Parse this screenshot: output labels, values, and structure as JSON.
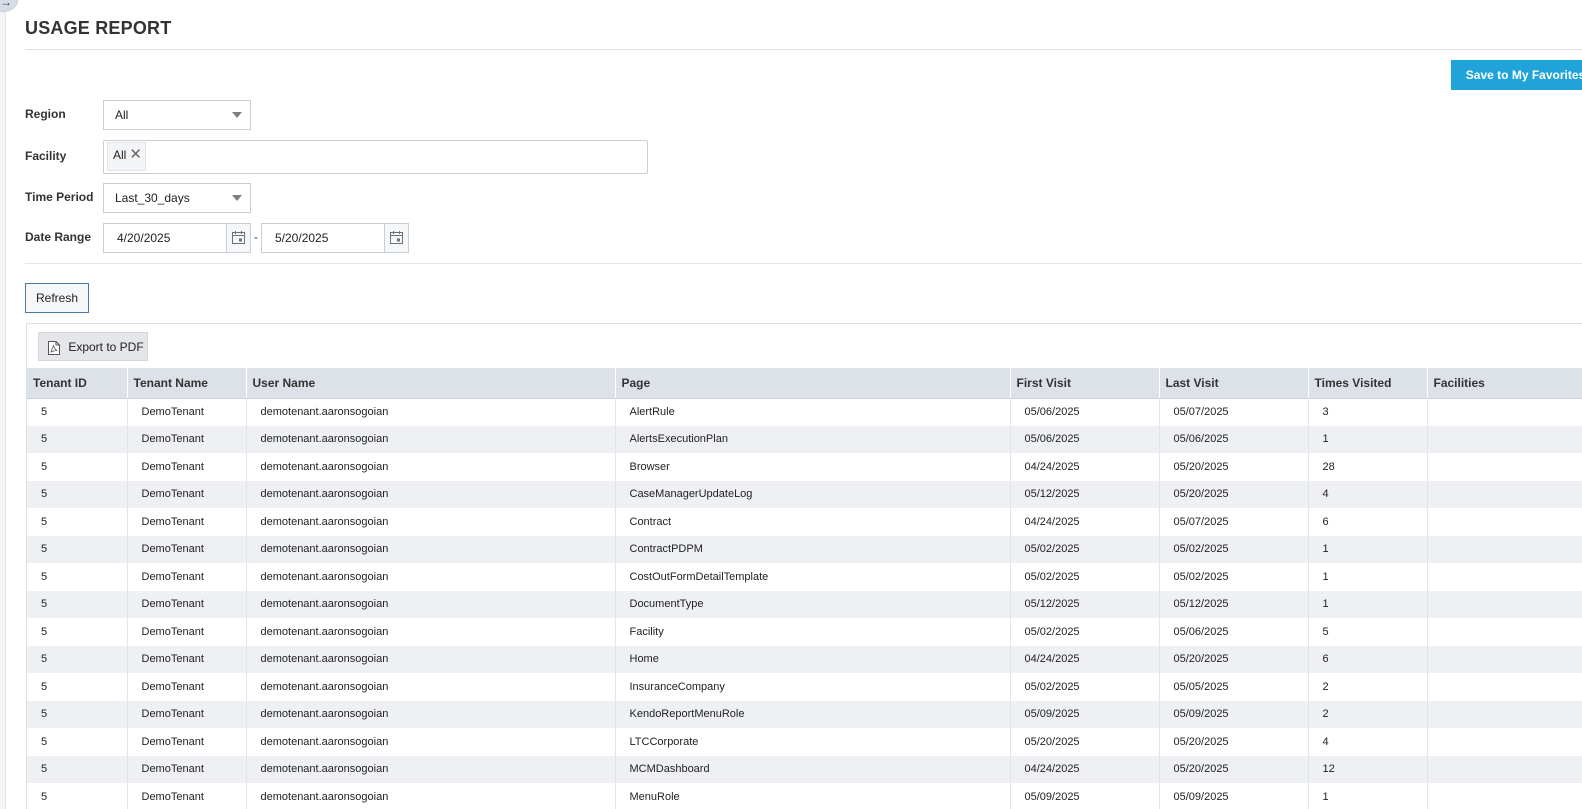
{
  "header": {
    "title": "USAGE REPORT",
    "favorites_label": "Save to My Favorites"
  },
  "filters": {
    "region": {
      "label": "Region",
      "value": "All"
    },
    "facility": {
      "label": "Facility",
      "chips": [
        "All"
      ]
    },
    "time_period": {
      "label": "Time Period",
      "value": "Last_30_days"
    },
    "date_range": {
      "label": "Date Range",
      "start": "4/20/2025",
      "separator": "-",
      "end": "5/20/2025"
    }
  },
  "actions": {
    "refresh_label": "Refresh",
    "export_label": "Export to PDF"
  },
  "table": {
    "columns": [
      "Tenant ID",
      "Tenant Name",
      "User Name",
      "Page",
      "First Visit",
      "Last Visit",
      "Times Visited",
      "Facilities"
    ],
    "rows": [
      [
        "5",
        "DemoTenant",
        "demotenant.aaronsogoian",
        "AlertRule",
        "05/06/2025",
        "05/07/2025",
        "3",
        ""
      ],
      [
        "5",
        "DemoTenant",
        "demotenant.aaronsogoian",
        "AlertsExecutionPlan",
        "05/06/2025",
        "05/06/2025",
        "1",
        ""
      ],
      [
        "5",
        "DemoTenant",
        "demotenant.aaronsogoian",
        "Browser",
        "04/24/2025",
        "05/20/2025",
        "28",
        ""
      ],
      [
        "5",
        "DemoTenant",
        "demotenant.aaronsogoian",
        "CaseManagerUpdateLog",
        "05/12/2025",
        "05/20/2025",
        "4",
        ""
      ],
      [
        "5",
        "DemoTenant",
        "demotenant.aaronsogoian",
        "Contract",
        "04/24/2025",
        "05/07/2025",
        "6",
        ""
      ],
      [
        "5",
        "DemoTenant",
        "demotenant.aaronsogoian",
        "ContractPDPM",
        "05/02/2025",
        "05/02/2025",
        "1",
        ""
      ],
      [
        "5",
        "DemoTenant",
        "demotenant.aaronsogoian",
        "CostOutFormDetailTemplate",
        "05/02/2025",
        "05/02/2025",
        "1",
        ""
      ],
      [
        "5",
        "DemoTenant",
        "demotenant.aaronsogoian",
        "DocumentType",
        "05/12/2025",
        "05/12/2025",
        "1",
        ""
      ],
      [
        "5",
        "DemoTenant",
        "demotenant.aaronsogoian",
        "Facility",
        "05/02/2025",
        "05/06/2025",
        "5",
        ""
      ],
      [
        "5",
        "DemoTenant",
        "demotenant.aaronsogoian",
        "Home",
        "04/24/2025",
        "05/20/2025",
        "6",
        ""
      ],
      [
        "5",
        "DemoTenant",
        "demotenant.aaronsogoian",
        "InsuranceCompany",
        "05/02/2025",
        "05/05/2025",
        "2",
        ""
      ],
      [
        "5",
        "DemoTenant",
        "demotenant.aaronsogoian",
        "KendoReportMenuRole",
        "05/09/2025",
        "05/09/2025",
        "2",
        ""
      ],
      [
        "5",
        "DemoTenant",
        "demotenant.aaronsogoian",
        "LTCCorporate",
        "05/20/2025",
        "05/20/2025",
        "4",
        ""
      ],
      [
        "5",
        "DemoTenant",
        "demotenant.aaronsogoian",
        "MCMDashboard",
        "04/24/2025",
        "05/20/2025",
        "12",
        ""
      ],
      [
        "5",
        "DemoTenant",
        "demotenant.aaronsogoian",
        "MenuRole",
        "05/09/2025",
        "05/09/2025",
        "1",
        ""
      ]
    ]
  }
}
